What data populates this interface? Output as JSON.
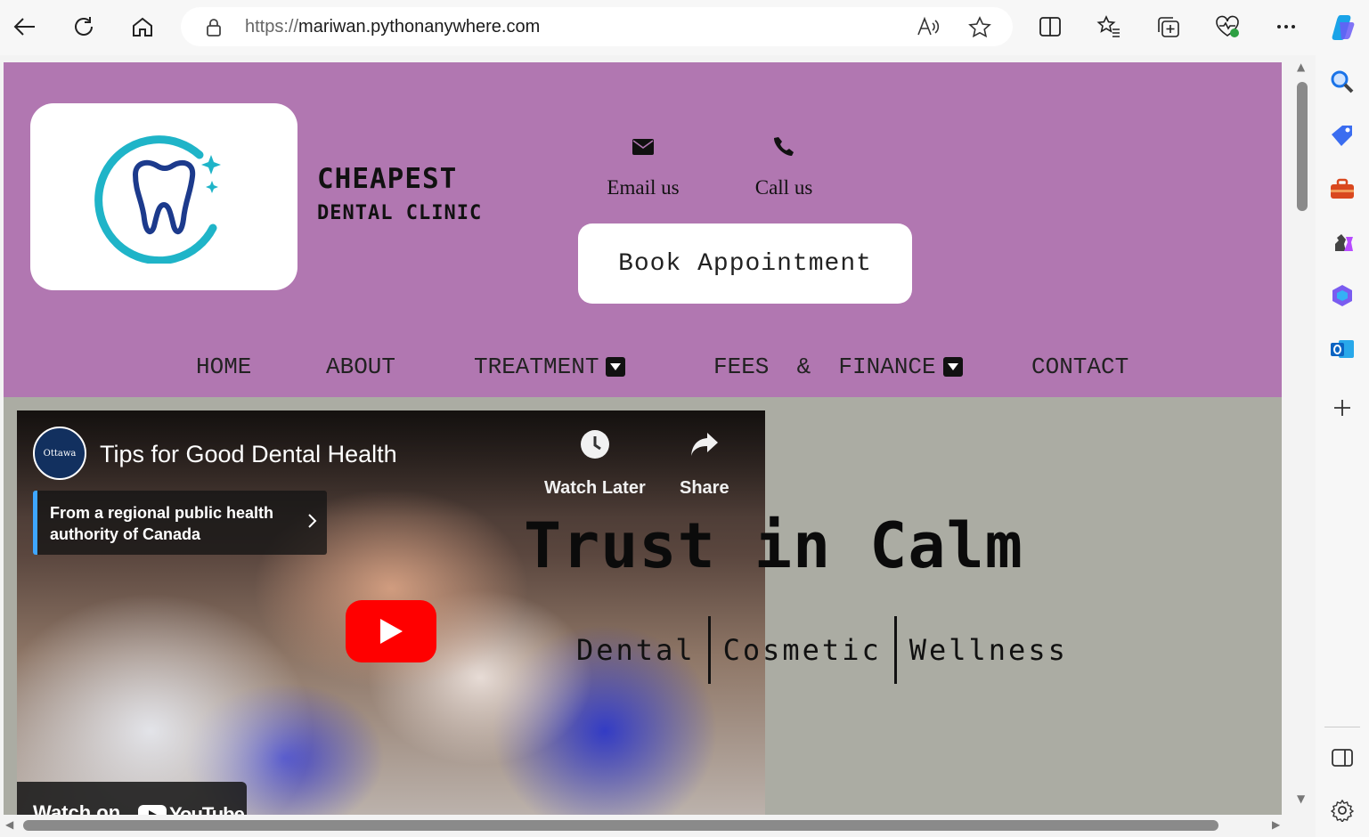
{
  "browser": {
    "url_scheme": "https://",
    "url_host": "mariwan.pythonanywhere.com"
  },
  "header": {
    "brand_line1": "CHEAPEST",
    "brand_line2": "DENTAL CLINIC",
    "email_label": "Email us",
    "call_label": "Call us",
    "book_label": "Book Appointment",
    "colors": {
      "header_bg": "#b177b1",
      "hero_bg": "#abaca3"
    }
  },
  "nav": {
    "home": "HOME",
    "about": "ABOUT",
    "treatment": "TREATMENT",
    "fees": "FEES  &  FINANCE",
    "contact": "CONTACT"
  },
  "video": {
    "title": "Tips for Good Dental Health",
    "channel_logo_text": "Ottawa",
    "info_card": "From a regional public health authority of Canada",
    "watch_later": "Watch Later",
    "share": "Share",
    "watch_on": "Watch on",
    "youtube": "YouTube"
  },
  "hero": {
    "title": "Trust in Calm",
    "tag1": "Dental",
    "tag2": "Cosmetic",
    "tag3": "Wellness"
  }
}
